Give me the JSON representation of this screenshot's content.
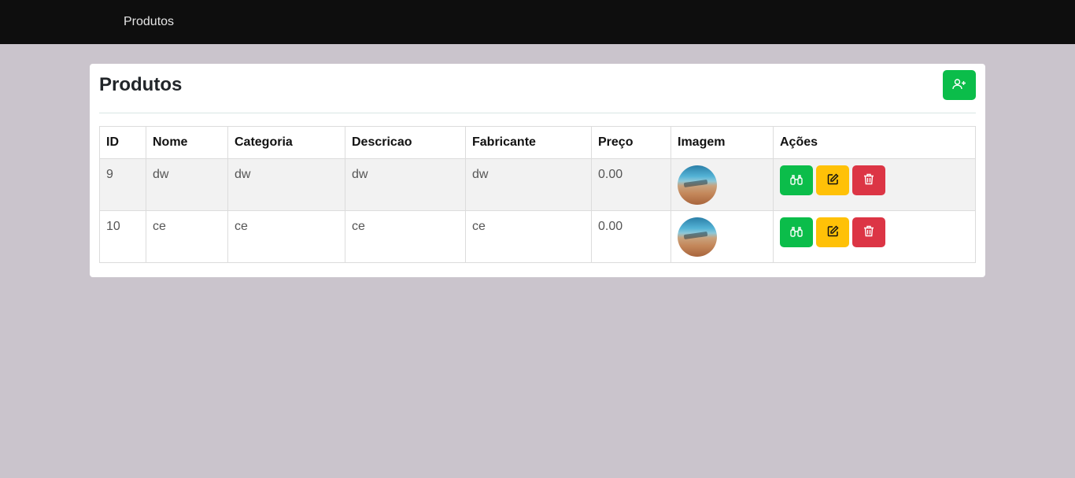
{
  "navbar": {
    "brand": "Produtos"
  },
  "card": {
    "title": "Produtos",
    "add_icon": "person-plus-icon"
  },
  "table": {
    "headers": [
      "ID",
      "Nome",
      "Categoria",
      "Descricao",
      "Fabricante",
      "Preço",
      "Imagem",
      "Ações"
    ],
    "rows": [
      {
        "id": "9",
        "nome": "dw",
        "categoria": "dw",
        "descricao": "dw",
        "fabricante": "dw",
        "preco": "0.00",
        "imagem": "product-thumbnail"
      },
      {
        "id": "10",
        "nome": "ce",
        "categoria": "ce",
        "descricao": "ce",
        "fabricante": "ce",
        "preco": "0.00",
        "imagem": "product-thumbnail"
      }
    ]
  },
  "action_icons": {
    "view": "binoculars-icon",
    "edit": "edit-square-icon",
    "delete": "trash-icon"
  },
  "colors": {
    "view": "#0bbd4a",
    "edit": "#ffc107",
    "delete": "#dc3545",
    "navbar": "#0e0e0e",
    "background": "#cac4cc"
  }
}
